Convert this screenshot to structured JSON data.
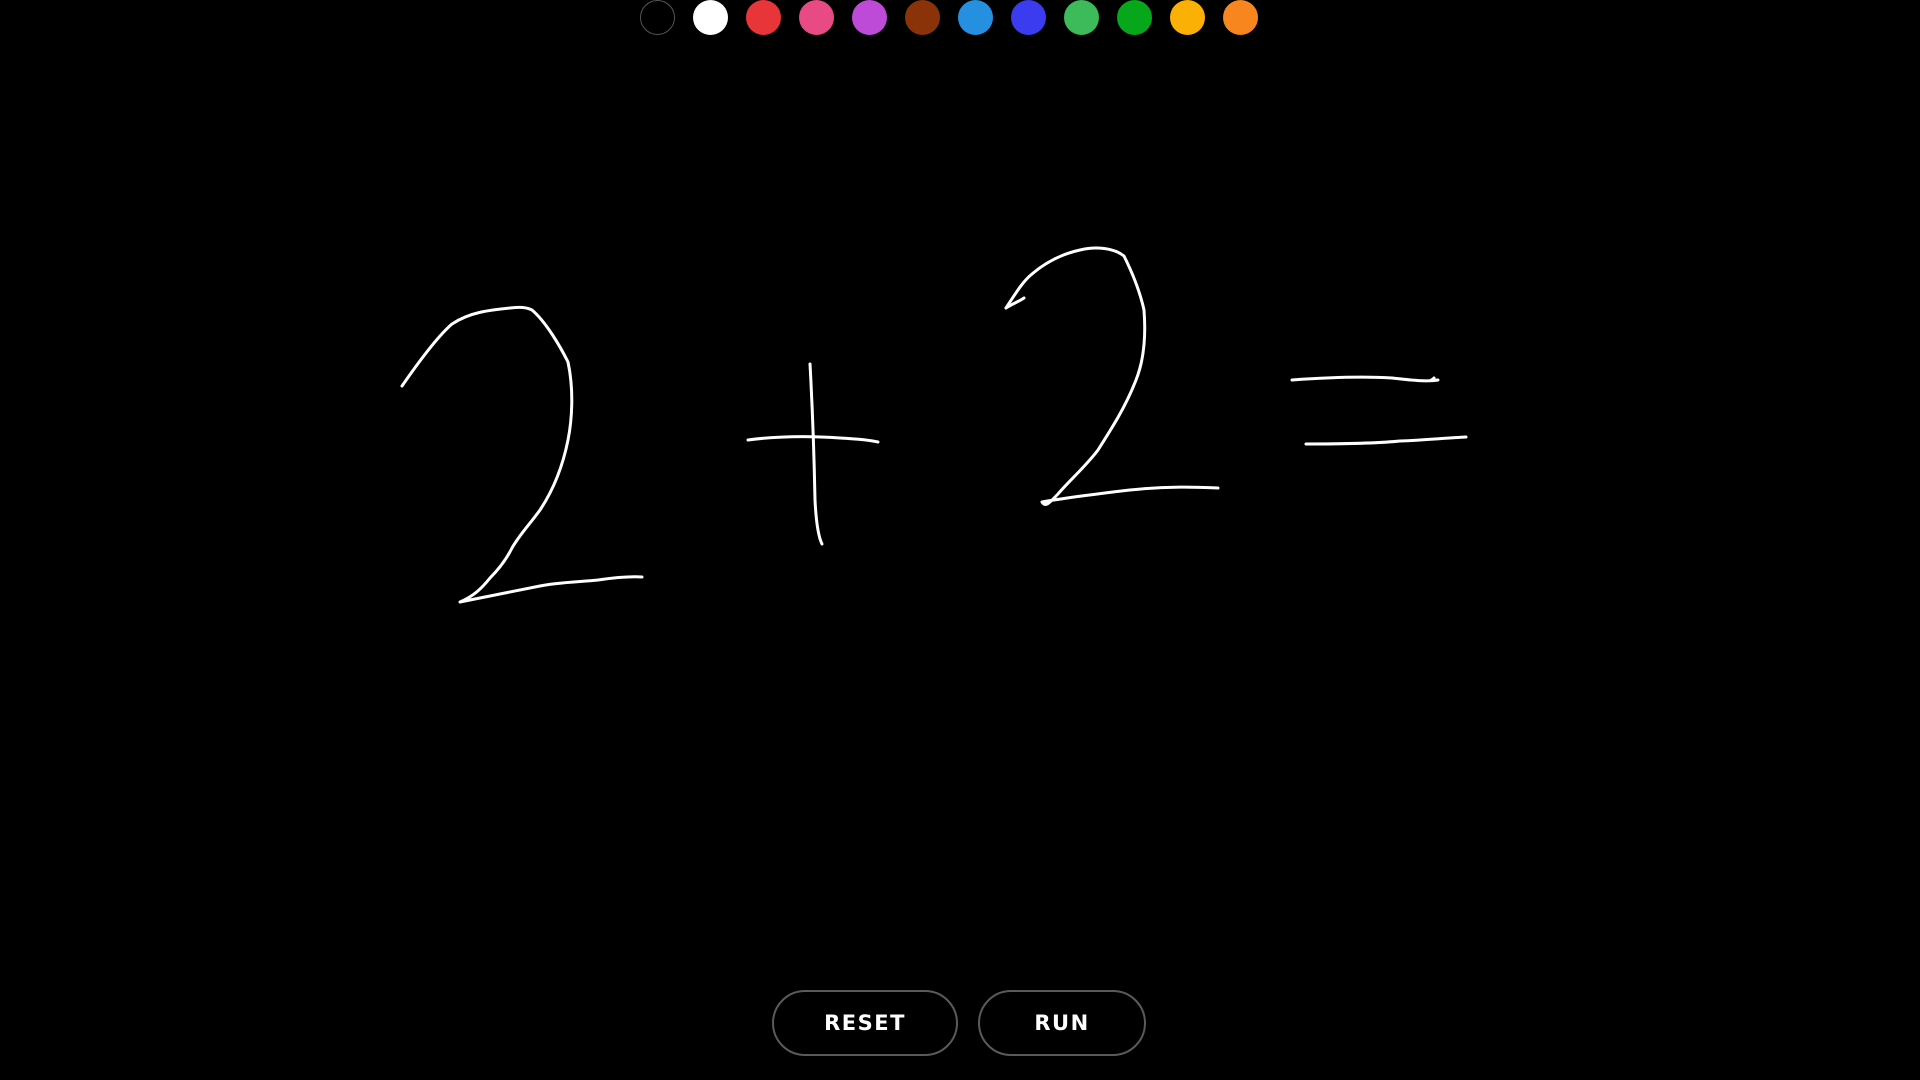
{
  "palette": {
    "colors": [
      {
        "name": "black",
        "hex": "#000000"
      },
      {
        "name": "white",
        "hex": "#ffffff"
      },
      {
        "name": "red",
        "hex": "#e8353a"
      },
      {
        "name": "pink",
        "hex": "#e84a83"
      },
      {
        "name": "purple",
        "hex": "#be4ad8"
      },
      {
        "name": "brown",
        "hex": "#8a3309"
      },
      {
        "name": "light-blue",
        "hex": "#2690e0"
      },
      {
        "name": "blue",
        "hex": "#3b3bef"
      },
      {
        "name": "light-green",
        "hex": "#3dba5a"
      },
      {
        "name": "green",
        "hex": "#06a71b"
      },
      {
        "name": "amber",
        "hex": "#fbb005"
      },
      {
        "name": "orange",
        "hex": "#f8861e"
      }
    ],
    "selected": "white"
  },
  "canvas": {
    "background": "#000000",
    "stroke_color": "#ffffff",
    "drawn_expression": "2+2="
  },
  "controls": {
    "reset_label": "RESET",
    "run_label": "RUN"
  }
}
